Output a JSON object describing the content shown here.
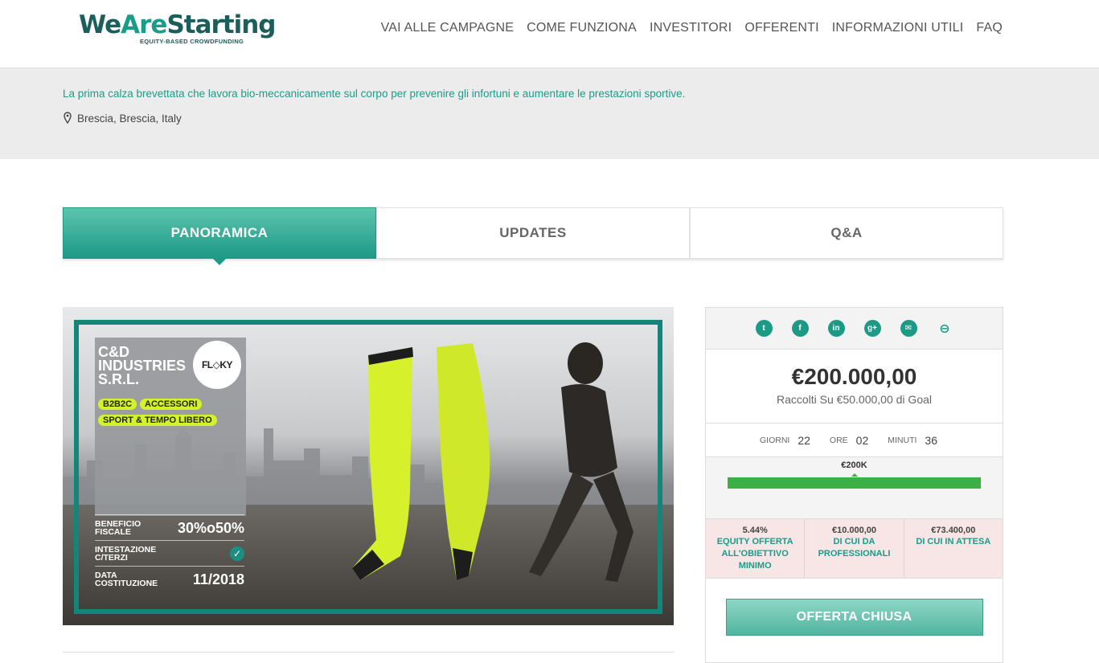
{
  "brand": {
    "name_part1": "We",
    "name_part2": "Are",
    "name_part3": "Starting",
    "sub": "EQUITY-BASED CROWDFUNDING"
  },
  "nav": [
    "VAI ALLE CAMPAGNE",
    "COME FUNZIONA",
    "INVESTITORI",
    "OFFERENTI",
    "INFORMAZIONI UTILI",
    "FAQ"
  ],
  "hero": {
    "tagline": "La prima calza brevettata che lavora bio-meccanicamente sul corpo per prevenire gli infortuni e aumentare le prestazioni sportive.",
    "location": "Brescia, Brescia, Italy"
  },
  "tabs": [
    "PANORAMICA",
    "UPDATES",
    "Q&A"
  ],
  "banner": {
    "company": [
      "C&D",
      "INDUSTRIES",
      "S.R.L."
    ],
    "logo_text": "FL◇KY",
    "tags": [
      "B2B2C",
      "ACCESSORI",
      "SPORT & TEMPO LIBERO"
    ],
    "facts": [
      {
        "label1": "BENEFICIO",
        "label2": "FISCALE",
        "value": "30%o50%"
      },
      {
        "label1": "INTESTAZIONE",
        "label2": "C/TERZI",
        "value": "✓"
      },
      {
        "label1": "DATA",
        "label2": "COSTITUZIONE",
        "value": "11/2018"
      }
    ]
  },
  "panel": {
    "social_icons": [
      "twitter-icon",
      "facebook-icon",
      "linkedin-icon",
      "google-plus-icon",
      "email-icon",
      "link-icon"
    ],
    "social_glyphs": [
      "t",
      "f",
      "in",
      "g+",
      "✉",
      "⊖"
    ],
    "raised_amount": "€200.000,00",
    "raised_sub": "Raccolti Su €50.000,00 di Goal",
    "timer": {
      "days_label": "GIORNI",
      "days": "22",
      "hours_label": "ORE",
      "hours": "02",
      "minutes_label": "MINUTI",
      "minutes": "36"
    },
    "progress_label": "€200K",
    "progress_fraction": 1.0,
    "stats": [
      {
        "value": "5.44%",
        "desc": "EQUITY OFFERTA ALL'OBIETTIVO MINIMO"
      },
      {
        "value": "€10.000,00",
        "desc": "DI CUI DA PROFESSIONALI"
      },
      {
        "value": "€73.400,00",
        "desc": "DI CUI IN ATTESA"
      }
    ],
    "cta": "OFFERTA CHIUSA"
  },
  "colors": {
    "accent": "#1a9c8a",
    "progress": "#3db043",
    "stats_bg": "#f8e5e5"
  }
}
